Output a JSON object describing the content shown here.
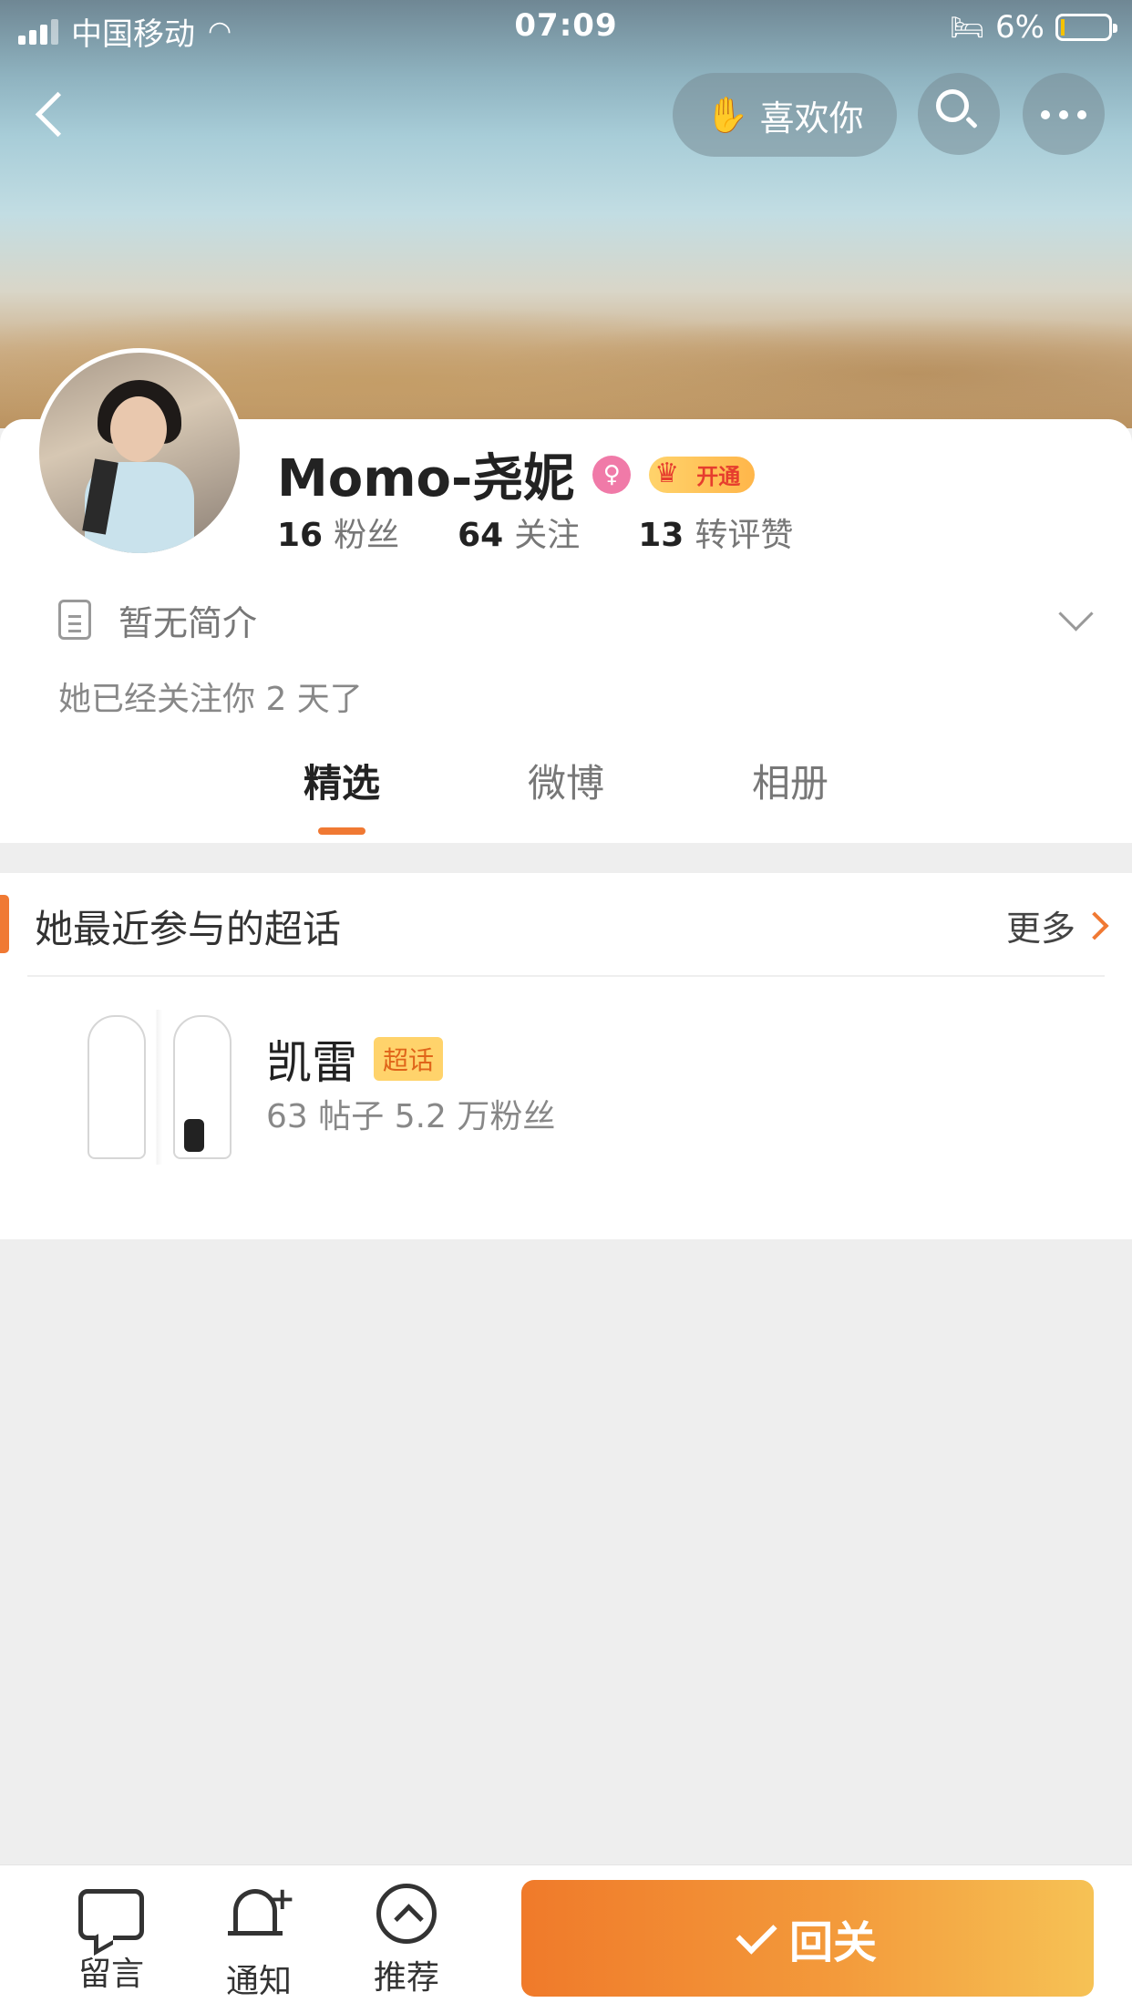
{
  "status_bar": {
    "carrier": "中国移动",
    "time": "07:09",
    "battery": "6%"
  },
  "nav": {
    "like_button_label": "喜欢你"
  },
  "profile": {
    "username": "Momo-尧妮",
    "vip_label": "开通",
    "stats": [
      {
        "value": "16",
        "label": "粉丝"
      },
      {
        "value": "64",
        "label": "关注"
      },
      {
        "value": "13",
        "label": "转评赞"
      }
    ],
    "bio": "暂无简介",
    "follow_note": "她已经关注你 2 天了"
  },
  "tabs": [
    {
      "label": "精选",
      "active": true
    },
    {
      "label": "微博",
      "active": false
    },
    {
      "label": "相册",
      "active": false
    }
  ],
  "super_topics": {
    "title": "她最近参与的超话",
    "more_label": "更多",
    "items": [
      {
        "name": "凯雷",
        "badge": "超话",
        "meta": "63 帖子 5.2 万粉丝"
      }
    ]
  },
  "bottom_bar": {
    "message_label": "留言",
    "notify_label": "通知",
    "recommend_label": "推荐",
    "follow_back_label": "回关"
  },
  "colors": {
    "accent": "#f07933",
    "vip_gold": "#ffb64a",
    "female_pink": "#f07aa8"
  }
}
